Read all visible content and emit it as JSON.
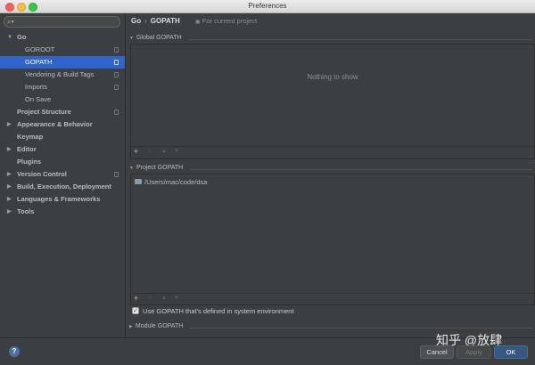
{
  "window": {
    "title": "Preferences"
  },
  "search": {
    "placeholder": ""
  },
  "sidebar": {
    "items": [
      {
        "label": "Go",
        "level": 0,
        "bold": true,
        "arrow": "▼",
        "selected": false,
        "project_icon": false
      },
      {
        "label": "GOROOT",
        "level": 1,
        "bold": false,
        "arrow": "",
        "selected": false,
        "project_icon": true
      },
      {
        "label": "GOPATH",
        "level": 1,
        "bold": false,
        "arrow": "",
        "selected": true,
        "project_icon": true
      },
      {
        "label": "Vendoring & Build Tags",
        "level": 1,
        "bold": false,
        "arrow": "",
        "selected": false,
        "project_icon": true
      },
      {
        "label": "Imports",
        "level": 1,
        "bold": false,
        "arrow": "",
        "selected": false,
        "project_icon": true
      },
      {
        "label": "On Save",
        "level": 1,
        "bold": false,
        "arrow": "",
        "selected": false,
        "project_icon": false
      },
      {
        "label": "Project Structure",
        "level": 0,
        "bold": true,
        "arrow": "",
        "selected": false,
        "project_icon": true
      },
      {
        "label": "Appearance & Behavior",
        "level": 0,
        "bold": true,
        "arrow": "▶",
        "selected": false,
        "project_icon": false
      },
      {
        "label": "Keymap",
        "level": 0,
        "bold": true,
        "arrow": "",
        "selected": false,
        "project_icon": false
      },
      {
        "label": "Editor",
        "level": 0,
        "bold": true,
        "arrow": "▶",
        "selected": false,
        "project_icon": false
      },
      {
        "label": "Plugins",
        "level": 0,
        "bold": true,
        "arrow": "",
        "selected": false,
        "project_icon": false
      },
      {
        "label": "Version Control",
        "level": 0,
        "bold": true,
        "arrow": "▶",
        "selected": false,
        "project_icon": true
      },
      {
        "label": "Build, Execution, Deployment",
        "level": 0,
        "bold": true,
        "arrow": "▶",
        "selected": false,
        "project_icon": false
      },
      {
        "label": "Languages & Frameworks",
        "level": 0,
        "bold": true,
        "arrow": "▶",
        "selected": false,
        "project_icon": false
      },
      {
        "label": "Tools",
        "level": 0,
        "bold": true,
        "arrow": "▶",
        "selected": false,
        "project_icon": false
      }
    ]
  },
  "main": {
    "breadcrumb": {
      "root": "Go",
      "separator": "›",
      "current": "GOPATH"
    },
    "scope_label": "For current project",
    "global_gopath": {
      "title": "Global GOPATH",
      "empty_text": "Nothing to show"
    },
    "project_gopath": {
      "title": "Project GOPATH",
      "paths": [
        "/Users/mac/code/dsa"
      ]
    },
    "use_system_gopath": {
      "label": "Use GOPATH that's defined in system environment",
      "checked": true
    },
    "module_gopath": {
      "title": "Module GOPATH"
    },
    "toolbar": {
      "add": "+",
      "remove": "−",
      "up": "▲",
      "down": "▼"
    }
  },
  "footer": {
    "help": "?",
    "watermark": "知乎 @放肆",
    "cancel": "Cancel",
    "apply": "Apply",
    "ok": "OK"
  },
  "colors": {
    "selection": "#2f65ca",
    "ok_button": "#365880",
    "background": "#3c3f41"
  }
}
